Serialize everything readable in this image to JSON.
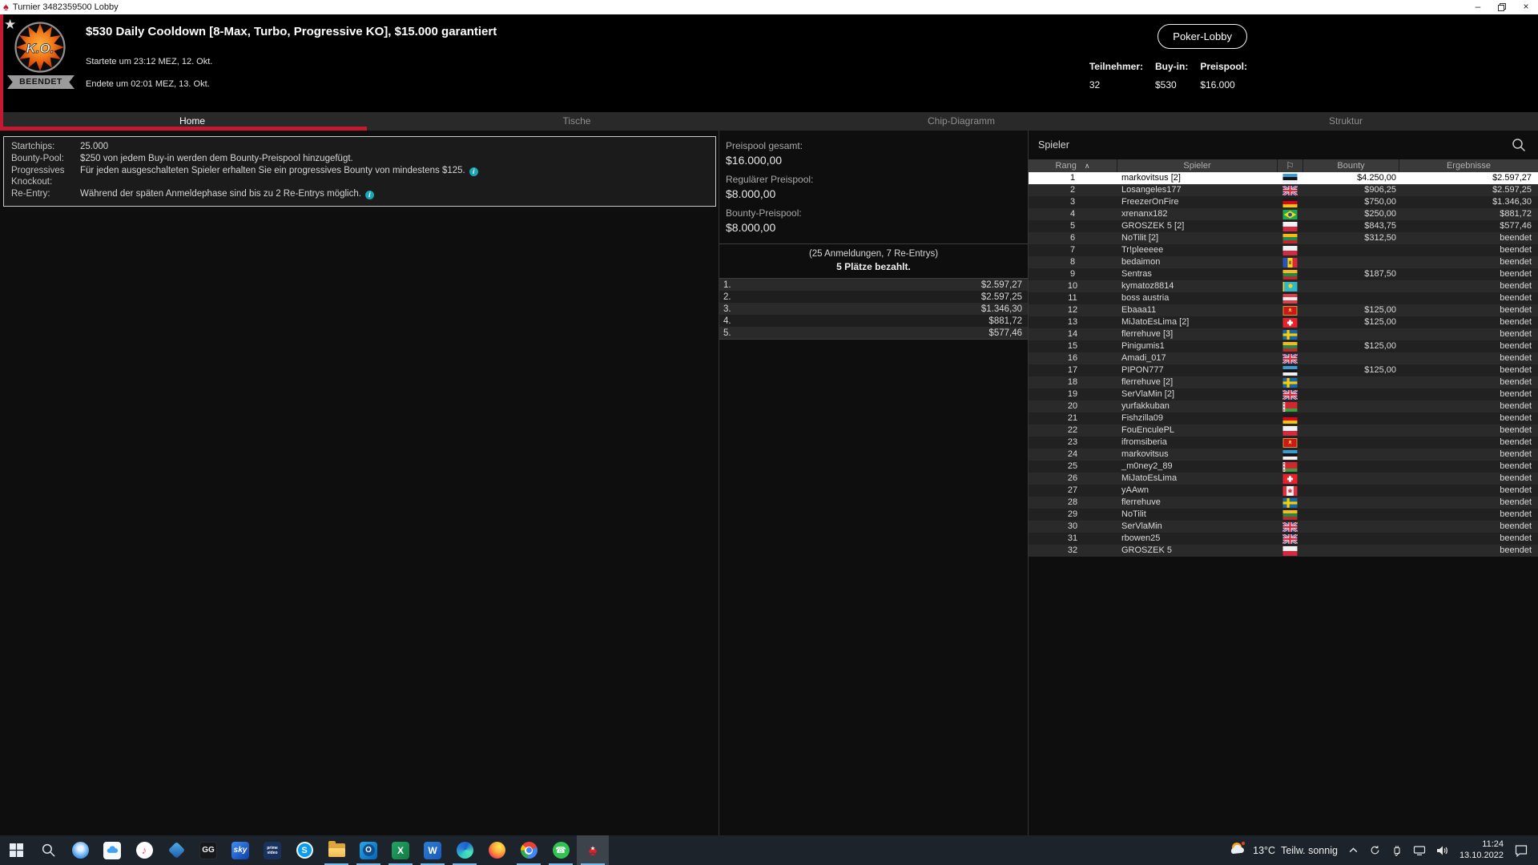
{
  "titlebar": {
    "title": "Turnier 3482359500 Lobby"
  },
  "header": {
    "title": "$530 Daily Cooldown [8-Max, Turbo, Progressive KO], $15.000 garantiert",
    "started": "Startete um 23:12 MEZ, 12. Okt.",
    "ended": "Endete um 02:01 MEZ, 13. Okt.",
    "status_badge": "BEENDET",
    "logo_text": "K.O.",
    "lobby_button": "Poker-Lobby",
    "stats": [
      {
        "label": "Teilnehmer:",
        "value": "32"
      },
      {
        "label": "Buy-in:",
        "value": "$530"
      },
      {
        "label": "Preispool:",
        "value": "$16.000"
      }
    ]
  },
  "tabs": [
    {
      "label": "Home",
      "active": true
    },
    {
      "label": "Tische",
      "active": false
    },
    {
      "label": "Chip-Diagramm",
      "active": false
    },
    {
      "label": "Struktur",
      "active": false
    }
  ],
  "info_panel": {
    "rows": [
      {
        "label": "Startchips:",
        "text": "25.000",
        "info": false
      },
      {
        "label": "Bounty-Pool:",
        "text": "$250 von jedem Buy-in werden dem Bounty-Preispool hinzugefügt.",
        "info": false
      },
      {
        "label": "Progressives Knockout:",
        "text": "Für jeden ausgeschalteten Spieler erhalten Sie ein progressives Bounty von mindestens $125.",
        "info": true
      },
      {
        "label": "Re-Entry:",
        "text": "Während der späten Anmeldephase sind bis zu 2 Re-Entrys möglich.",
        "info": true
      }
    ]
  },
  "prize_panel": {
    "pools": [
      {
        "label": "Preispool gesamt:",
        "value": "$16.000,00"
      },
      {
        "label": "Regulärer Preispool:",
        "value": "$8.000,00"
      },
      {
        "label": "Bounty-Preispool:",
        "value": "$8.000,00"
      }
    ],
    "entries_line": "(25 Anmeldungen, 7 Re-Entrys)",
    "paid_line": "5 Plätze bezahlt.",
    "payouts": [
      {
        "place": "1.",
        "amount": "$2.597,27"
      },
      {
        "place": "2.",
        "amount": "$2.597,25"
      },
      {
        "place": "3.",
        "amount": "$1.346,30"
      },
      {
        "place": "4.",
        "amount": "$881,72"
      },
      {
        "place": "5.",
        "amount": "$577,46"
      }
    ]
  },
  "players_panel": {
    "title": "Spieler",
    "columns": {
      "rank": "Rang",
      "player": "Spieler",
      "bounty": "Bounty",
      "results": "Ergebnisse"
    },
    "rows": [
      {
        "rank": "1",
        "name": "markovitsus [2]",
        "flag": "ee",
        "bounty": "$4.250,00",
        "result": "$2.597,27",
        "selected": true
      },
      {
        "rank": "2",
        "name": "Losangeles177",
        "flag": "gb",
        "bounty": "$906,25",
        "result": "$2.597,25"
      },
      {
        "rank": "3",
        "name": "FreezerOnFire",
        "flag": "de",
        "bounty": "$750,00",
        "result": "$1.346,30"
      },
      {
        "rank": "4",
        "name": "xrenanx182",
        "flag": "br",
        "bounty": "$250,00",
        "result": "$881,72"
      },
      {
        "rank": "5",
        "name": "GROSZEK 5 [2]",
        "flag": "pl",
        "bounty": "$843,75",
        "result": "$577,46"
      },
      {
        "rank": "6",
        "name": "NoTilit [2]",
        "flag": "lt",
        "bounty": "$312,50",
        "result": "beendet"
      },
      {
        "rank": "7",
        "name": "Tr!pleeeee",
        "flag": "pl",
        "bounty": "",
        "result": "beendet"
      },
      {
        "rank": "8",
        "name": "bedaimon",
        "flag": "md",
        "bounty": "",
        "result": "beendet"
      },
      {
        "rank": "9",
        "name": "Sentras",
        "flag": "lt",
        "bounty": "$187,50",
        "result": "beendet"
      },
      {
        "rank": "10",
        "name": "kymatoz8814",
        "flag": "kz",
        "bounty": "",
        "result": "beendet"
      },
      {
        "rank": "11",
        "name": "boss austria",
        "flag": "at",
        "bounty": "",
        "result": "beendet"
      },
      {
        "rank": "12",
        "name": "Ebaaa11",
        "flag": "me",
        "bounty": "$125,00",
        "result": "beendet"
      },
      {
        "rank": "13",
        "name": "MiJatoEsLima [2]",
        "flag": "ch",
        "bounty": "$125,00",
        "result": "beendet"
      },
      {
        "rank": "14",
        "name": "flerrehuve [3]",
        "flag": "se",
        "bounty": "",
        "result": "beendet"
      },
      {
        "rank": "15",
        "name": "Pinigumis1",
        "flag": "lt",
        "bounty": "$125,00",
        "result": "beendet"
      },
      {
        "rank": "16",
        "name": "Amadi_017",
        "flag": "gb",
        "bounty": "",
        "result": "beendet"
      },
      {
        "rank": "17",
        "name": "PIPON777",
        "flag": "ee",
        "bounty": "$125,00",
        "result": "beendet"
      },
      {
        "rank": "18",
        "name": "flerrehuve [2]",
        "flag": "se",
        "bounty": "",
        "result": "beendet"
      },
      {
        "rank": "19",
        "name": "SerVlaMin [2]",
        "flag": "gb",
        "bounty": "",
        "result": "beendet"
      },
      {
        "rank": "20",
        "name": "yurfakkuban",
        "flag": "by",
        "bounty": "",
        "result": "beendet"
      },
      {
        "rank": "21",
        "name": "Fishzilla09",
        "flag": "de",
        "bounty": "",
        "result": "beendet"
      },
      {
        "rank": "22",
        "name": "FouEnculePL",
        "flag": "pl",
        "bounty": "",
        "result": "beendet"
      },
      {
        "rank": "23",
        "name": "ifromsiberia",
        "flag": "me",
        "bounty": "",
        "result": "beendet"
      },
      {
        "rank": "24",
        "name": "markovitsus",
        "flag": "ee",
        "bounty": "",
        "result": "beendet"
      },
      {
        "rank": "25",
        "name": "_m0ney2_89",
        "flag": "by",
        "bounty": "",
        "result": "beendet"
      },
      {
        "rank": "26",
        "name": "MiJatoEsLima",
        "flag": "ch",
        "bounty": "",
        "result": "beendet"
      },
      {
        "rank": "27",
        "name": "yAAwn",
        "flag": "ca",
        "bounty": "",
        "result": "beendet"
      },
      {
        "rank": "28",
        "name": "flerrehuve",
        "flag": "se",
        "bounty": "",
        "result": "beendet"
      },
      {
        "rank": "29",
        "name": "NoTilit",
        "flag": "lt",
        "bounty": "",
        "result": "beendet"
      },
      {
        "rank": "30",
        "name": "SerVlaMin",
        "flag": "gb",
        "bounty": "",
        "result": "beendet"
      },
      {
        "rank": "31",
        "name": "rbowen25",
        "flag": "gb",
        "bounty": "",
        "result": "beendet"
      },
      {
        "rank": "32",
        "name": "GROSZEK 5",
        "flag": "pl",
        "bounty": "",
        "result": "beendet"
      }
    ]
  },
  "taskbar": {
    "apps": [
      {
        "name": "start"
      },
      {
        "name": "search"
      },
      {
        "name": "signal"
      },
      {
        "name": "icloud"
      },
      {
        "name": "apple-music"
      },
      {
        "name": "pokerstars-vr"
      },
      {
        "name": "ggpoker",
        "label": "GG"
      },
      {
        "name": "sky",
        "label": "sky"
      },
      {
        "name": "prime-video",
        "label": "prime video"
      },
      {
        "name": "skype",
        "label": "S"
      },
      {
        "name": "file-explorer",
        "running": true
      },
      {
        "name": "outlook",
        "label": "O",
        "running": true
      },
      {
        "name": "excel",
        "label": "X",
        "running": true
      },
      {
        "name": "word",
        "label": "W",
        "running": true
      },
      {
        "name": "edge",
        "running": true
      },
      {
        "name": "firefox"
      },
      {
        "name": "chrome",
        "running": true
      },
      {
        "name": "whatsapp",
        "running": true
      },
      {
        "name": "pokerstars",
        "running": true,
        "active": true
      }
    ],
    "weather": {
      "temp": "13°C",
      "condition": "Teilw. sonnig"
    },
    "tray": [
      {
        "name": "hidden-icons-chevron"
      },
      {
        "name": "sync"
      },
      {
        "name": "usb-device"
      },
      {
        "name": "network"
      },
      {
        "name": "volume"
      }
    ],
    "clock": {
      "time": "11:24",
      "date": "13.10.2022"
    },
    "colors": {
      "indicator": "#76b9ed"
    }
  },
  "colors": {
    "accent_red": "#c51931",
    "info_icon": "#18a7b8",
    "selected_row": "#ffffff"
  }
}
